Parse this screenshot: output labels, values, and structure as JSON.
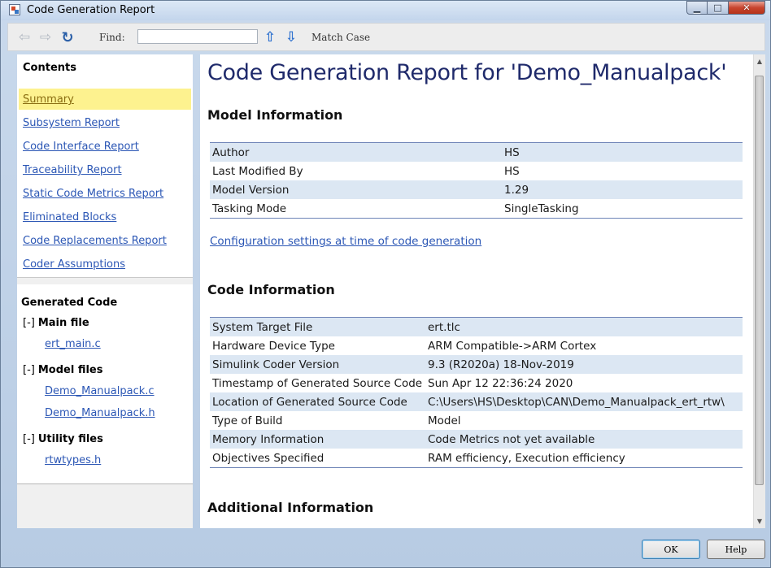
{
  "window": {
    "title": "Code Generation Report"
  },
  "toolbar": {
    "find_label": "Find:",
    "find_value": "",
    "match_case_label": "Match Case"
  },
  "nav": {
    "contents_heading": "Contents",
    "links": [
      {
        "label": "Summary",
        "active": true
      },
      {
        "label": "Subsystem Report"
      },
      {
        "label": "Code Interface Report"
      },
      {
        "label": "Traceability Report"
      },
      {
        "label": "Static Code Metrics Report"
      },
      {
        "label": "Eliminated Blocks"
      },
      {
        "label": "Code Replacements Report"
      },
      {
        "label": "Coder Assumptions"
      }
    ],
    "generated_heading": "Generated Code",
    "groups": [
      {
        "toggle": "[-]",
        "label": "Main file",
        "files": [
          "ert_main.c"
        ]
      },
      {
        "toggle": "[-]",
        "label": "Model files",
        "files": [
          "Demo_Manualpack.c",
          "Demo_Manualpack.h"
        ]
      },
      {
        "toggle": "[-]",
        "label": "Utility files",
        "files": [
          "rtwtypes.h"
        ]
      }
    ]
  },
  "report": {
    "title": "Code Generation Report for 'Demo_Manualpack'",
    "model_info_heading": "Model Information",
    "model_info": [
      [
        "Author",
        "HS"
      ],
      [
        "Last Modified By",
        "HS"
      ],
      [
        "Model Version",
        "1.29"
      ],
      [
        "Tasking Mode",
        "SingleTasking"
      ]
    ],
    "config_link": "Configuration settings at time of code generation",
    "code_info_heading": "Code Information",
    "code_info": [
      [
        "System Target File",
        "ert.tlc"
      ],
      [
        "Hardware Device Type",
        "ARM Compatible->ARM Cortex"
      ],
      [
        "Simulink Coder Version",
        "9.3 (R2020a) 18-Nov-2019"
      ],
      [
        "Timestamp of Generated Source Code",
        "Sun Apr 12 22:36:24 2020"
      ],
      [
        "Location of Generated Source Code",
        "C:\\Users\\HS\\Desktop\\CAN\\Demo_Manualpack_ert_rtw\\"
      ],
      [
        "Type of Build",
        "Model"
      ],
      [
        "Memory Information",
        "Code Metrics not yet available"
      ],
      [
        "Objectives Specified",
        "RAM efficiency, Execution efficiency"
      ]
    ],
    "additional_heading": "Additional Information"
  },
  "buttons": {
    "ok": "OK",
    "help": "Help"
  }
}
